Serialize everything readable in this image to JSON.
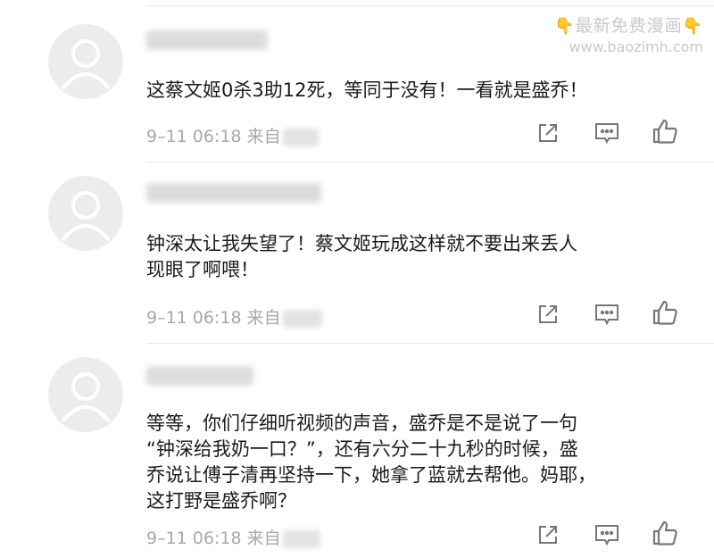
{
  "watermark": {
    "title": "最新免费漫画",
    "url": "www.baozimh.com"
  },
  "icons": {
    "share": "share-icon",
    "reply": "comment-icon",
    "like": "thumbs-up-icon",
    "avatar": "default-avatar-icon"
  },
  "comments": [
    {
      "text": "这蔡文姬0杀3助12死，等同于没有！一看就是盛乔！",
      "time": "9–11 06:18",
      "from_label": "来自"
    },
    {
      "text": "钟深太让我失望了！蔡文姬玩成这样就不要出来丢人\n现眼了啊喂！",
      "time": "9–11 06:18",
      "from_label": "来自"
    },
    {
      "text": "等等，你们仔细听视频的声音，盛乔是不是说了一句\n“钟深给我奶一口？”，还有六分二十九秒的时候，盛\n乔说让傅子清再坚持一下，她拿了蓝就去帮他。妈耶，\n这打野是盛乔啊？",
      "time": "9–11 06:18",
      "from_label": "来自"
    }
  ]
}
